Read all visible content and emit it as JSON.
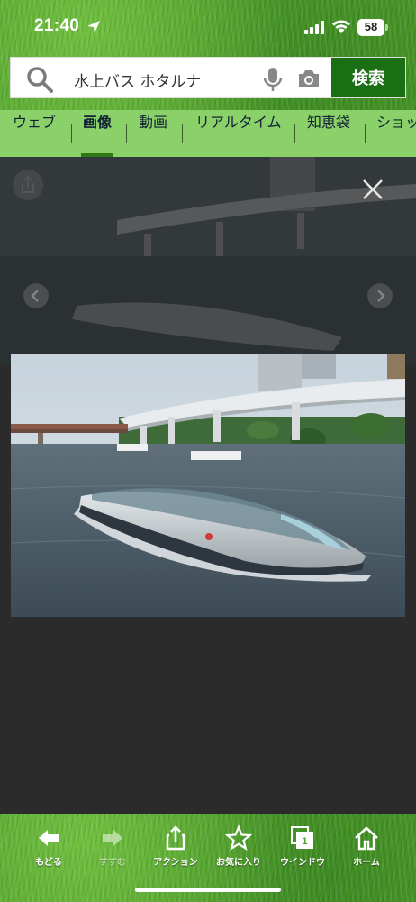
{
  "status_bar": {
    "time": "21:40",
    "battery_level": "58",
    "icons": [
      "location-arrow-icon",
      "signal-icon",
      "wifi-icon",
      "battery-icon"
    ]
  },
  "search": {
    "query": "水上バス ホタルナ",
    "button_label": "検索",
    "icons": [
      "search-icon",
      "microphone-icon",
      "camera-icon"
    ]
  },
  "tabs": [
    {
      "label": "ウェブ",
      "active": false
    },
    {
      "label": "画像",
      "active": true
    },
    {
      "label": "動画",
      "active": false
    },
    {
      "label": "リアルタイム",
      "active": false
    },
    {
      "label": "知恵袋",
      "active": false
    },
    {
      "label": "ショッ",
      "active": false
    }
  ],
  "viewer": {
    "icons": [
      "share-icon",
      "close-icon",
      "chevron-left-icon",
      "chevron-right-icon"
    ],
    "photo_subject": "water-bus-boat-photo"
  },
  "toolbar": {
    "items": [
      {
        "label": "もどる",
        "icon": "arrow-left-icon",
        "enabled": true
      },
      {
        "label": "すすむ",
        "icon": "arrow-right-icon",
        "enabled": false
      },
      {
        "label": "アクション",
        "icon": "share-icon",
        "enabled": true
      },
      {
        "label": "お気に入り",
        "icon": "star-icon",
        "enabled": true
      },
      {
        "label": "ウインドウ",
        "icon": "window-icon",
        "enabled": true
      },
      {
        "label": "ホーム",
        "icon": "home-icon",
        "enabled": true
      }
    ]
  },
  "colors": {
    "search_button": "#1a6e14",
    "tabs_background": "#8bd16a",
    "viewer_background": "#2b2b2b"
  }
}
